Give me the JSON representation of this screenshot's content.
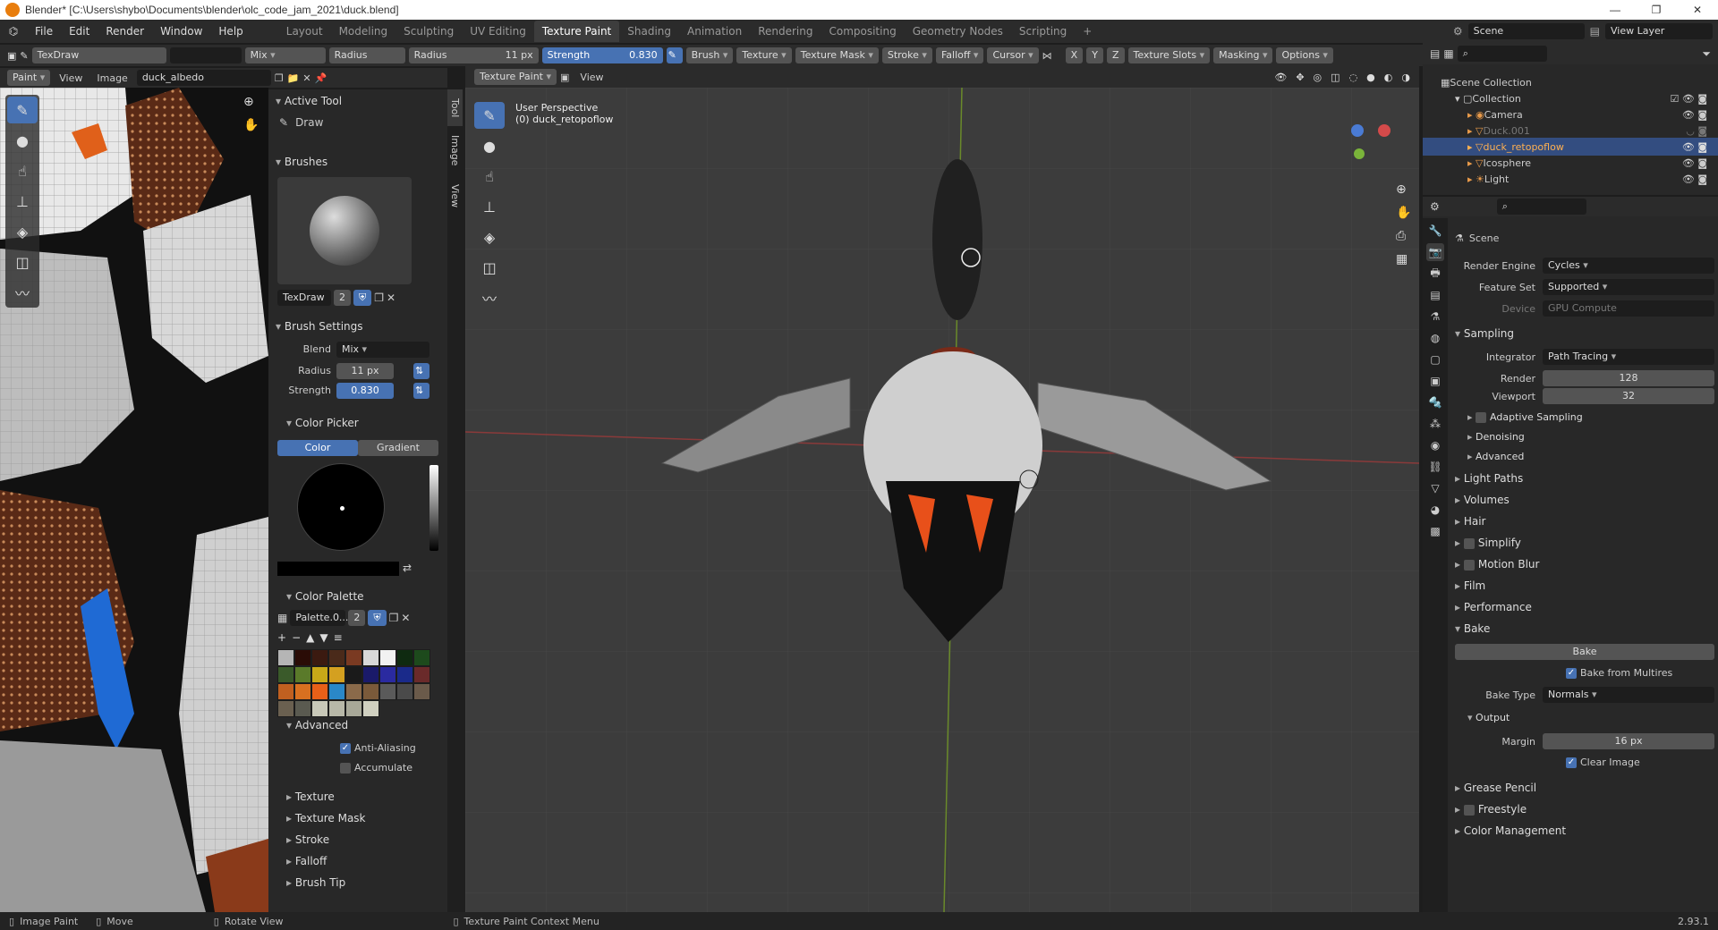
{
  "title": "Blender* [C:\\Users\\shybo\\Documents\\blender\\olc_code_jam_2021\\duck.blend]",
  "menu": [
    "File",
    "Edit",
    "Render",
    "Window",
    "Help"
  ],
  "workspaces": [
    "Layout",
    "Modeling",
    "Sculpting",
    "UV Editing",
    "Texture Paint",
    "Shading",
    "Animation",
    "Rendering",
    "Compositing",
    "Geometry Nodes",
    "Scripting"
  ],
  "scene": "Scene",
  "view_layer": "View Layer",
  "toolheader": {
    "brush": "TexDraw",
    "blend": "Mix",
    "radius_label": "Radius",
    "radius": "11 px",
    "strength_label": "Strength",
    "strength": "0.830",
    "menus": [
      "Brush",
      "Texture",
      "Texture Mask",
      "Stroke",
      "Falloff",
      "Cursor"
    ],
    "axes": [
      "X",
      "Y",
      "Z"
    ],
    "right": [
      "Texture Slots",
      "Masking",
      "Options"
    ]
  },
  "img_header": {
    "mode": "Paint",
    "view": "View",
    "image_menu": "Image",
    "image": "duck_albedo"
  },
  "vp_header": {
    "mode": "Texture Paint",
    "view": "View"
  },
  "vp_overlay": {
    "line1": "User Perspective",
    "line2": "(0) duck_retopoflow"
  },
  "tabs_side": [
    "Tool",
    "Image",
    "View"
  ],
  "npanel": {
    "active_tool": "Active Tool",
    "tool_name": "Draw",
    "brushes": "Brushes",
    "brush_name": "TexDraw",
    "brush_users": "2",
    "brush_settings": "Brush Settings",
    "blend_label": "Blend",
    "blend": "Mix",
    "radius_label": "Radius",
    "radius": "11 px",
    "strength_label": "Strength",
    "strength": "0.830",
    "color_picker": "Color Picker",
    "color_tab": "Color",
    "gradient_tab": "Gradient",
    "color_palette": "Color Palette",
    "palette_name": "Palette.0...",
    "palette_users": "2",
    "advanced": "Advanced",
    "anti_aliasing": "Anti-Aliasing",
    "accumulate": "Accumulate",
    "collapsed": [
      "Texture",
      "Texture Mask",
      "Stroke",
      "Falloff",
      "Brush Tip"
    ]
  },
  "palette_colors": [
    "#b5b5b5",
    "#2a0c06",
    "#3b1a10",
    "#4a2a1a",
    "#7a3a22",
    "#d8d8d8",
    "#f2f2f2",
    "#0f2a10",
    "#1d4a1c",
    "#3a5a2a",
    "#5a7a2a",
    "#c8a818",
    "#d4a020",
    "#1a1a1a",
    "#1a1a6a",
    "#2a2aa0",
    "#1a2a8a",
    "#6a2a2a",
    "#c06020",
    "#d87020",
    "#e86018",
    "#2a88c8",
    "#8a6a4a",
    "#7a5a3a",
    "#5a5a5a",
    "#4a4a4a",
    "#6a5a4a",
    "#6a6050",
    "#5a5a50",
    "#c8c8b8",
    "#b8b8a8",
    "#a8a898",
    "#d0d0c0"
  ],
  "outliner": {
    "root": "Scene Collection",
    "collection": "Collection",
    "items": [
      "Camera",
      "Duck.001",
      "duck_retopoflow",
      "Icosphere",
      "Light"
    ]
  },
  "props": {
    "scene": "Scene",
    "render_engine_label": "Render Engine",
    "render_engine": "Cycles",
    "feature_set_label": "Feature Set",
    "feature_set": "Supported",
    "device_label": "Device",
    "device": "GPU Compute",
    "sampling": "Sampling",
    "integrator_label": "Integrator",
    "integrator": "Path Tracing",
    "render_label": "Render",
    "render": "128",
    "viewport_label": "Viewport",
    "viewport": "32",
    "adaptive": "Adaptive Sampling",
    "denoising": "Denoising",
    "advanced": "Advanced",
    "sections": [
      "Light Paths",
      "Volumes",
      "Hair",
      "Simplify",
      "Motion Blur",
      "Film",
      "Performance"
    ],
    "bake": "Bake",
    "bake_button": "Bake",
    "bake_multires": "Bake from Multires",
    "bake_type_label": "Bake Type",
    "bake_type": "Normals",
    "output": "Output",
    "margin_label": "Margin",
    "margin": "16 px",
    "clear_image": "Clear Image",
    "bottom_sections": [
      "Grease Pencil",
      "Freestyle",
      "Color Management"
    ]
  },
  "status": {
    "left": "Image Paint",
    "move": "Move",
    "rotate": "Rotate View",
    "context": "Texture Paint Context Menu",
    "version": "2.93.1"
  }
}
